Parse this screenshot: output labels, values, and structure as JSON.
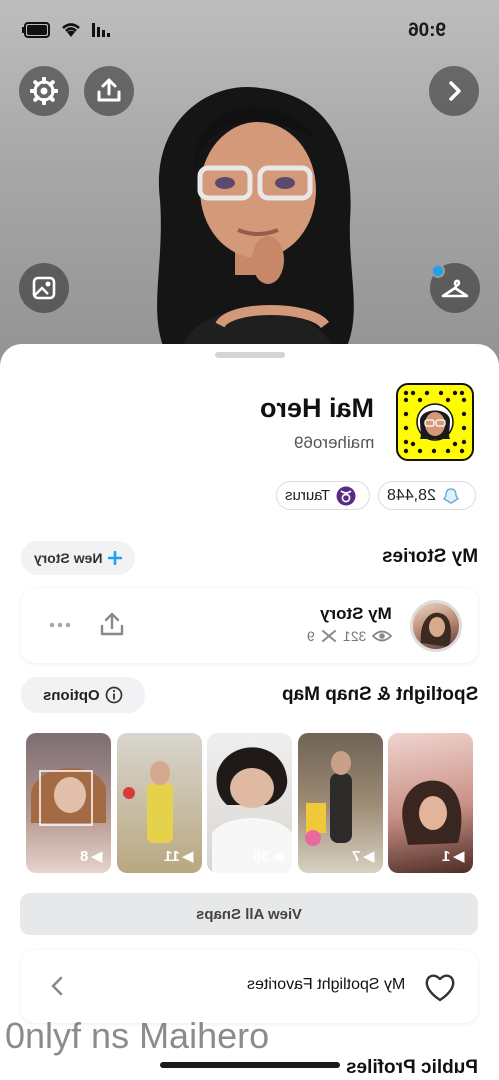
{
  "status": {
    "time": "9:06"
  },
  "profile": {
    "display_name": "Mai Hero",
    "username": "maihero69",
    "score": "28,448",
    "zodiac": "Taurus"
  },
  "stories": {
    "title": "My Stories",
    "new_story_label": "New Story",
    "my_story": {
      "name": "My Story",
      "views": "321",
      "screenshots": "9"
    }
  },
  "spotlight": {
    "title": "Spotlight & Snap Map",
    "options_label": "Options",
    "thumbnails": [
      {
        "count": "1"
      },
      {
        "count": "7"
      },
      {
        "count": "36"
      },
      {
        "count": "11"
      },
      {
        "count": "8"
      }
    ],
    "view_all_label": "View All Snaps",
    "favorites_label": "My Spotlight Favorites"
  },
  "public_profiles": {
    "title": "Public Profiles"
  },
  "watermark": "0nlyf ns Maihero",
  "colors": {
    "snapcode_yellow": "#fffc00",
    "accent_blue": "#1ea1f1",
    "zodiac_purple": "#5b2a86"
  },
  "icons": [
    "settings-icon",
    "share-icon",
    "chevron-right-icon",
    "gallery-icon",
    "hanger-icon",
    "bitmoji-avatar",
    "snapcode",
    "ghost-icon",
    "taurus-icon",
    "plus-icon",
    "info-icon",
    "eye-icon",
    "screenshot-icon",
    "more-icon",
    "heart-icon",
    "chevron-left-icon"
  ]
}
